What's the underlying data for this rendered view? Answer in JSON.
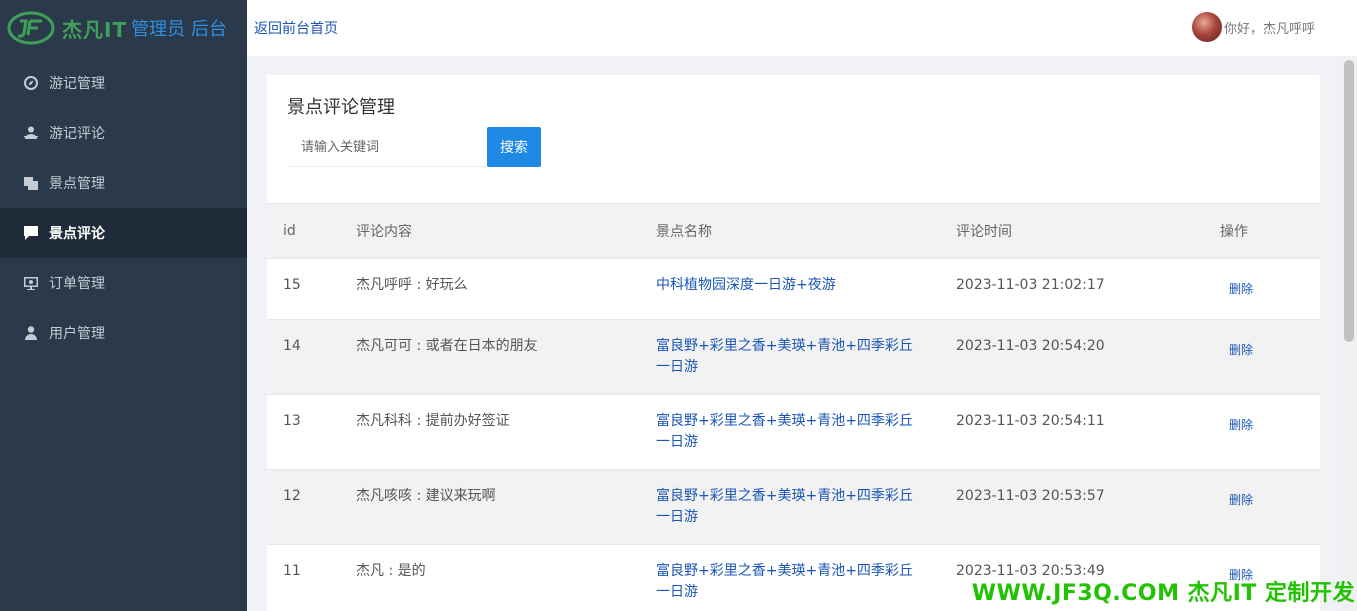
{
  "logo": {
    "brand": "杰凡IT",
    "sub": "管理员 后台"
  },
  "sidebar": {
    "items": [
      {
        "label": "游记管理",
        "icon": "compass-icon"
      },
      {
        "label": "游记评论",
        "icon": "user-review-icon"
      },
      {
        "label": "景点管理",
        "icon": "copy-icon"
      },
      {
        "label": "景点评论",
        "icon": "comment-icon"
      },
      {
        "label": "订单管理",
        "icon": "monitor-icon"
      },
      {
        "label": "用户管理",
        "icon": "user-icon"
      }
    ],
    "active_index": 3,
    "bg_color": "#2b3a4a"
  },
  "topbar": {
    "back_link": "返回前台首页",
    "greeting": "你好，杰凡呼呼"
  },
  "panel": {
    "title": "景点评论管理",
    "search_placeholder": "请输入关键词",
    "search_button": "搜索"
  },
  "table": {
    "headers": {
      "id": "id",
      "content": "评论内容",
      "spot": "景点名称",
      "time": "评论时间",
      "op": "操作"
    },
    "rows": [
      {
        "id": "15",
        "content": "杰凡呼呼 : 好玩么",
        "spot": "中科植物园深度一日游+夜游",
        "time": "2023-11-03 21:02:17",
        "action": "删除"
      },
      {
        "id": "14",
        "content": "杰凡可可 : 或者在日本的朋友",
        "spot": "富良野+彩里之香+美瑛+青池+四季彩丘一日游",
        "time": "2023-11-03 20:54:20",
        "action": "删除"
      },
      {
        "id": "13",
        "content": "杰凡科科 : 提前办好签证",
        "spot": "富良野+彩里之香+美瑛+青池+四季彩丘一日游",
        "time": "2023-11-03 20:54:11",
        "action": "删除"
      },
      {
        "id": "12",
        "content": "杰凡咳咳 : 建议来玩啊",
        "spot": "富良野+彩里之香+美瑛+青池+四季彩丘一日游",
        "time": "2023-11-03 20:53:57",
        "action": "删除"
      },
      {
        "id": "11",
        "content": "杰凡 : 是的",
        "spot": "富良野+彩里之香+美瑛+青池+四季彩丘一日游",
        "time": "2023-11-03 20:53:49",
        "action": "删除"
      }
    ]
  },
  "watermark": "WWW.JF3Q.COM 杰凡IT  定制开发",
  "colors": {
    "link": "#1a56b5",
    "button": "#1e88e5",
    "brand_green": "#3fa05a",
    "watermark": "#21c200"
  }
}
